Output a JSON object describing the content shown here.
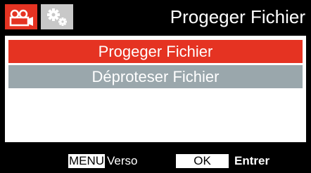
{
  "header": {
    "title": "Progeger Fichier",
    "tabs": [
      {
        "icon": "video-camera-icon",
        "active": true
      },
      {
        "icon": "gears-icon",
        "active": false
      }
    ]
  },
  "menu": {
    "items": [
      {
        "label": "Progeger Fichier",
        "selected": true
      },
      {
        "label": "Déproteser Fichier",
        "selected": false
      }
    ]
  },
  "footer": {
    "menu_key": "MENU",
    "menu_action": "Verso",
    "ok_key": "OK",
    "ok_action": "Entrer"
  },
  "colors": {
    "accent": "#e53322",
    "inactive_item": "#9aa7ac",
    "background": "#000000",
    "panel": "#ffffff"
  }
}
